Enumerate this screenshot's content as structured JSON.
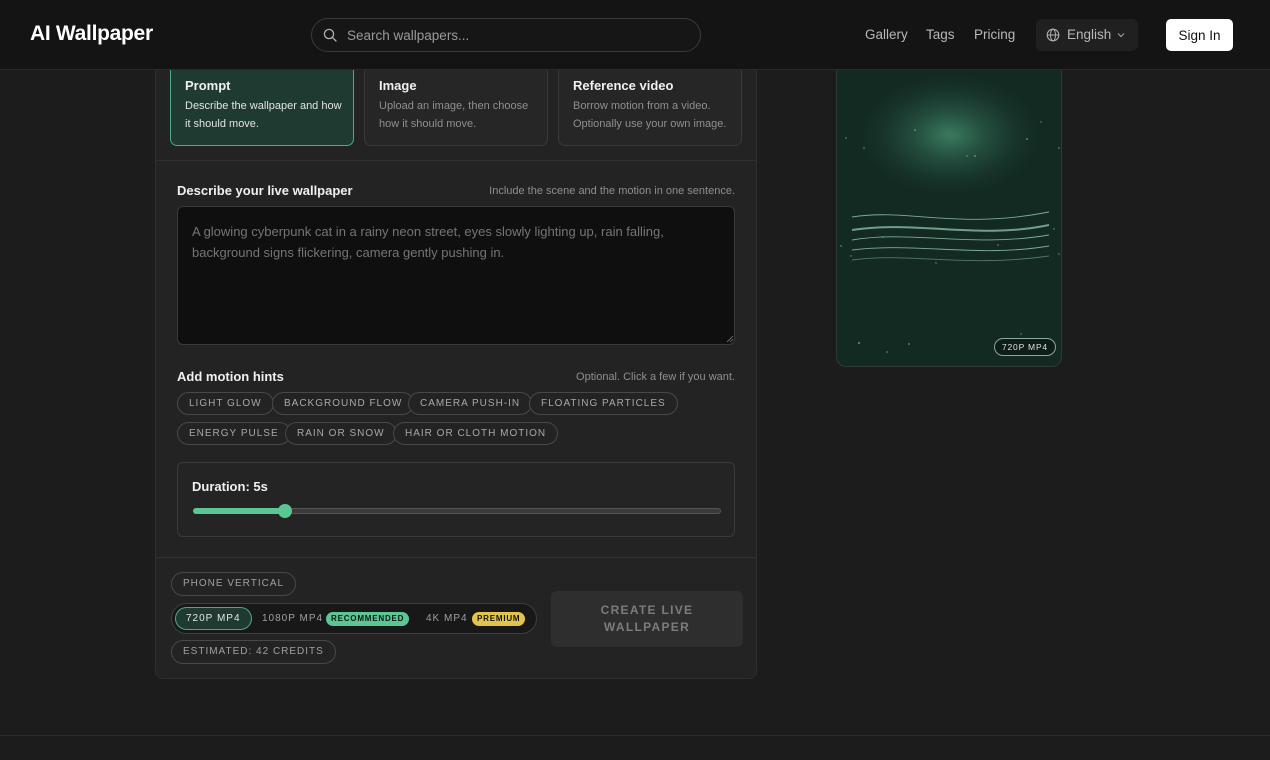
{
  "header": {
    "logo": "AI Wallpaper",
    "search_placeholder": "Search wallpapers...",
    "nav": [
      "Gallery",
      "Tags",
      "Pricing"
    ],
    "language": "English",
    "sign_in": "Sign In"
  },
  "modes": [
    {
      "title": "Prompt",
      "desc": "Describe the wallpaper and how it should move.",
      "active": true
    },
    {
      "title": "Image",
      "desc": "Upload an image, then choose how it should move.",
      "active": false
    },
    {
      "title": "Reference video",
      "desc": "Borrow motion from a video. Optionally use your own image.",
      "active": false
    }
  ],
  "describe": {
    "label": "Describe your live wallpaper",
    "hint": "Include the scene and the motion in one sentence.",
    "placeholder": "A glowing cyberpunk cat in a rainy neon street, eyes slowly lighting up, rain falling, background signs flickering, camera gently pushing in."
  },
  "motion_hints": {
    "label": "Add motion hints",
    "hint": "Optional. Click a few if you want.",
    "chips": [
      "LIGHT GLOW",
      "BACKGROUND FLOW",
      "CAMERA PUSH-IN",
      "FLOATING PARTICLES",
      "ENERGY PULSE",
      "RAIN OR SNOW",
      "HAIR OR CLOTH MOTION"
    ]
  },
  "duration": {
    "label": "Duration: 5s",
    "fraction": 0.175
  },
  "output": {
    "orientation": "PHONE VERTICAL",
    "resolutions": [
      {
        "label": "720P MP4",
        "active": true
      },
      {
        "label": "1080P MP4",
        "badge": "RECOMMENDED"
      },
      {
        "label": "4K MP4",
        "badge": "PREMIUM"
      }
    ],
    "estimate": "ESTIMATED: 42 CREDITS",
    "create_label": "CREATE LIVE WALLPAPER"
  },
  "preview": {
    "badge": "720P MP4"
  },
  "colors": {
    "accent": "#5cc594",
    "recommended_badge": "#5cc594",
    "premium_badge": "#e3c34c"
  },
  "icons": {
    "search": "search-icon",
    "globe": "globe-icon",
    "chevron": "chevron-down-icon"
  }
}
